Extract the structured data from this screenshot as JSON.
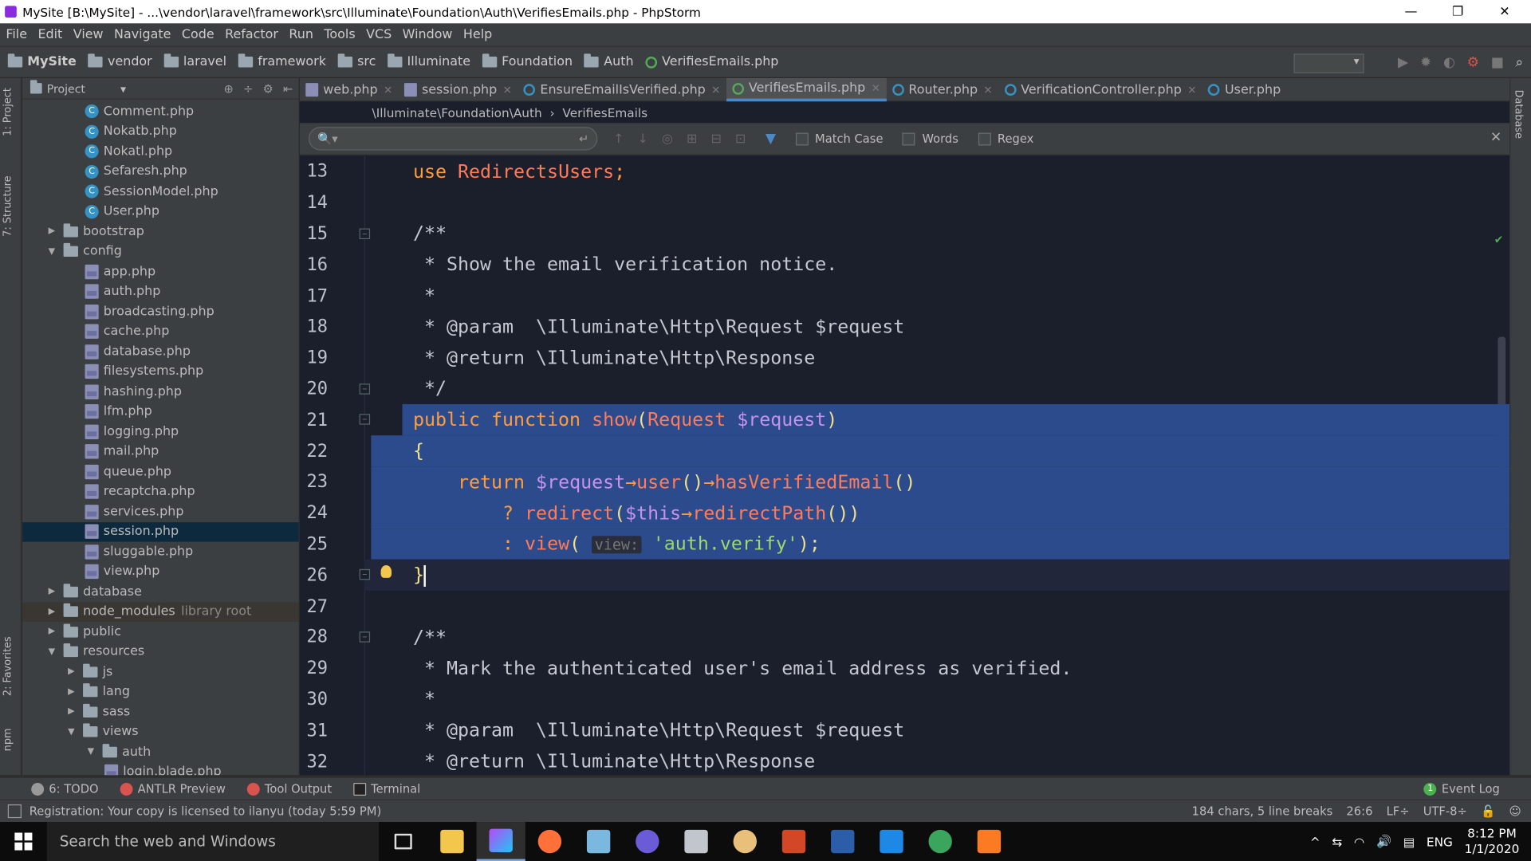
{
  "window": {
    "title": "MySite [B:\\MySite] - ...\\vendor\\laravel\\framework\\src\\Illuminate\\Foundation\\Auth\\VerifiesEmails.php - PhpStorm",
    "minimize": "—",
    "restore": "❐",
    "close": "✕"
  },
  "menu": [
    "File",
    "Edit",
    "View",
    "Navigate",
    "Code",
    "Refactor",
    "Run",
    "Tools",
    "VCS",
    "Window",
    "Help"
  ],
  "nav": {
    "crumbs": [
      "MySite",
      "vendor",
      "laravel",
      "framework",
      "src",
      "Illuminate",
      "Foundation",
      "Auth"
    ],
    "file": "VerifiesEmails.php",
    "run_config": "▾"
  },
  "left_strip": {
    "project": "1: Project",
    "structure": "7: Structure",
    "favorites": "2: Favorites",
    "npm": "npm"
  },
  "right_strip": {
    "database": "Database"
  },
  "project_panel": {
    "title": "Project",
    "dropdown": "▾"
  },
  "tree": [
    {
      "d": 3,
      "t": "cls",
      "label": "Comment.php"
    },
    {
      "d": 3,
      "t": "cls",
      "label": "Nokatb.php"
    },
    {
      "d": 3,
      "t": "cls",
      "label": "Nokatl.php"
    },
    {
      "d": 3,
      "t": "cls",
      "label": "Sefaresh.php"
    },
    {
      "d": 3,
      "t": "cls",
      "label": "SessionModel.php"
    },
    {
      "d": 3,
      "t": "cls",
      "label": "User.php"
    },
    {
      "d": 1,
      "t": "folder",
      "arrow": "▶",
      "label": "bootstrap"
    },
    {
      "d": 1,
      "t": "folder",
      "arrow": "▼",
      "label": "config"
    },
    {
      "d": 3,
      "t": "php",
      "label": "app.php"
    },
    {
      "d": 3,
      "t": "php",
      "label": "auth.php"
    },
    {
      "d": 3,
      "t": "php",
      "label": "broadcasting.php"
    },
    {
      "d": 3,
      "t": "php",
      "label": "cache.php"
    },
    {
      "d": 3,
      "t": "php",
      "label": "database.php"
    },
    {
      "d": 3,
      "t": "php",
      "label": "filesystems.php"
    },
    {
      "d": 3,
      "t": "php",
      "label": "hashing.php"
    },
    {
      "d": 3,
      "t": "php",
      "label": "lfm.php"
    },
    {
      "d": 3,
      "t": "php",
      "label": "logging.php"
    },
    {
      "d": 3,
      "t": "php",
      "label": "mail.php"
    },
    {
      "d": 3,
      "t": "php",
      "label": "queue.php"
    },
    {
      "d": 3,
      "t": "php",
      "label": "recaptcha.php"
    },
    {
      "d": 3,
      "t": "php",
      "label": "services.php"
    },
    {
      "d": 3,
      "t": "php",
      "label": "session.php",
      "sel": true
    },
    {
      "d": 3,
      "t": "php",
      "label": "sluggable.php"
    },
    {
      "d": 3,
      "t": "php",
      "label": "view.php"
    },
    {
      "d": 1,
      "t": "folder",
      "arrow": "▶",
      "label": "database"
    },
    {
      "d": 1,
      "t": "folder",
      "arrow": "▶",
      "label": "node_modules",
      "extra": "library root",
      "lib": true
    },
    {
      "d": 1,
      "t": "folder",
      "arrow": "▶",
      "label": "public"
    },
    {
      "d": 1,
      "t": "folder",
      "arrow": "▼",
      "label": "resources"
    },
    {
      "d": 2,
      "t": "folder",
      "arrow": "▶",
      "label": "js"
    },
    {
      "d": 2,
      "t": "folder",
      "arrow": "▶",
      "label": "lang"
    },
    {
      "d": 2,
      "t": "folder",
      "arrow": "▶",
      "label": "sass"
    },
    {
      "d": 2,
      "t": "folder",
      "arrow": "▼",
      "label": "views"
    },
    {
      "d": 3,
      "t": "folder",
      "arrow": "▼",
      "label": "auth"
    },
    {
      "d": 4,
      "t": "php",
      "label": "login.blade.php"
    }
  ],
  "tabs": [
    {
      "label": "web.php",
      "icon": "php"
    },
    {
      "label": "session.php",
      "icon": "php"
    },
    {
      "label": "EnsureEmailIsVerified.php",
      "icon": "cls"
    },
    {
      "label": "VerifiesEmails.php",
      "icon": "iface",
      "active": true
    },
    {
      "label": "Router.php",
      "icon": "cls"
    },
    {
      "label": "VerificationController.php",
      "icon": "cls"
    },
    {
      "label": "User.php",
      "icon": "cls",
      "noclose": true
    }
  ],
  "breadcrumb": {
    "ns": "\\Illuminate\\Foundation\\Auth",
    "sep": "›",
    "cls": "VerifiesEmails"
  },
  "find": {
    "search_icon": "🔍▾",
    "enter": "↵",
    "match_case": "Match Case",
    "words": "Words",
    "regex": "Regex",
    "close": "✕"
  },
  "code": [
    {
      "n": "13",
      "seg": [
        [
          "kw",
          "use "
        ],
        [
          "id",
          "RedirectsUsers"
        ],
        [
          "kw",
          ";"
        ]
      ]
    },
    {
      "n": "14",
      "seg": []
    },
    {
      "n": "15",
      "seg": [
        [
          "cm",
          "/**"
        ]
      ],
      "fold": "−"
    },
    {
      "n": "16",
      "seg": [
        [
          "cm",
          " * Show the email verification notice."
        ]
      ]
    },
    {
      "n": "17",
      "seg": [
        [
          "cm",
          " *"
        ]
      ]
    },
    {
      "n": "18",
      "seg": [
        [
          "cm",
          " * @param  \\Illuminate\\Http\\Request $request"
        ]
      ]
    },
    {
      "n": "19",
      "seg": [
        [
          "cm",
          " * @return \\Illuminate\\Http\\Response"
        ]
      ]
    },
    {
      "n": "20",
      "seg": [
        [
          "cm",
          " */"
        ]
      ],
      "fold": "−"
    },
    {
      "n": "21",
      "seg": [
        [
          "kw",
          "public function "
        ],
        [
          "fn",
          "show"
        ],
        [
          "op",
          "("
        ],
        [
          "id",
          "Request "
        ],
        [
          "var",
          "$request"
        ],
        [
          "op",
          ")"
        ]
      ],
      "fold": "−",
      "hl": true
    },
    {
      "n": "22",
      "seg": [
        [
          "op",
          "{"
        ]
      ],
      "hl": true
    },
    {
      "n": "23",
      "seg": [
        [
          "pl",
          "    "
        ],
        [
          "kw",
          "return "
        ],
        [
          "var",
          "$request"
        ],
        [
          "kw",
          "→"
        ],
        [
          "fn",
          "user"
        ],
        [
          "op",
          "()"
        ],
        [
          "kw",
          "→"
        ],
        [
          "fn",
          "hasVerifiedEmail"
        ],
        [
          "op",
          "()"
        ]
      ],
      "hl": true
    },
    {
      "n": "24",
      "seg": [
        [
          "pl",
          "        "
        ],
        [
          "kw",
          "? "
        ],
        [
          "fn",
          "redirect"
        ],
        [
          "op",
          "("
        ],
        [
          "var",
          "$this"
        ],
        [
          "kw",
          "→"
        ],
        [
          "fn",
          "redirectPath"
        ],
        [
          "op",
          "())"
        ]
      ],
      "hl": true
    },
    {
      "n": "25",
      "seg": [
        [
          "pl",
          "        "
        ],
        [
          "kw",
          ": "
        ],
        [
          "fn",
          "view"
        ],
        [
          "op",
          "( "
        ],
        [
          "hint",
          "view:"
        ],
        [
          "pl",
          " "
        ],
        [
          "str",
          "'auth.verify'"
        ],
        [
          "op",
          ");"
        ]
      ],
      "hl": true
    },
    {
      "n": "26",
      "seg": [
        [
          "op",
          "}"
        ]
      ],
      "caret": true,
      "fold": "−"
    },
    {
      "n": "27",
      "seg": []
    },
    {
      "n": "28",
      "seg": [
        [
          "cm",
          "/**"
        ]
      ],
      "fold": "−"
    },
    {
      "n": "29",
      "seg": [
        [
          "cm",
          " * Mark the authenticated user's email address as verified."
        ]
      ]
    },
    {
      "n": "30",
      "seg": [
        [
          "cm",
          " *"
        ]
      ]
    },
    {
      "n": "31",
      "seg": [
        [
          "cm",
          " * @param  \\Illuminate\\Http\\Request $request"
        ]
      ]
    },
    {
      "n": "32",
      "seg": [
        [
          "cm",
          " * @return \\Illuminate\\Http\\Response"
        ]
      ]
    }
  ],
  "toolwin": {
    "todo": "6: TODO",
    "antlr": "ANTLR Preview",
    "tool_output": "Tool Output",
    "terminal": "Terminal",
    "event_log": "Event Log",
    "event_count": "1"
  },
  "status": {
    "message": "Registration: Your copy is licensed to ilanyu (today 5:59 PM)",
    "chars": "184 chars, 5 line breaks",
    "pos": "26:6",
    "lf": "LF÷",
    "enc": "UTF-8÷"
  },
  "taskbar": {
    "search": "Search the web and Windows",
    "lang": "ENG",
    "time": "8:12 PM",
    "date": "1/1/2020"
  },
  "colors": {
    "accent": "#4a88c7",
    "selection": "#2c4b8d",
    "editor_bg": "#1b1e2b"
  }
}
